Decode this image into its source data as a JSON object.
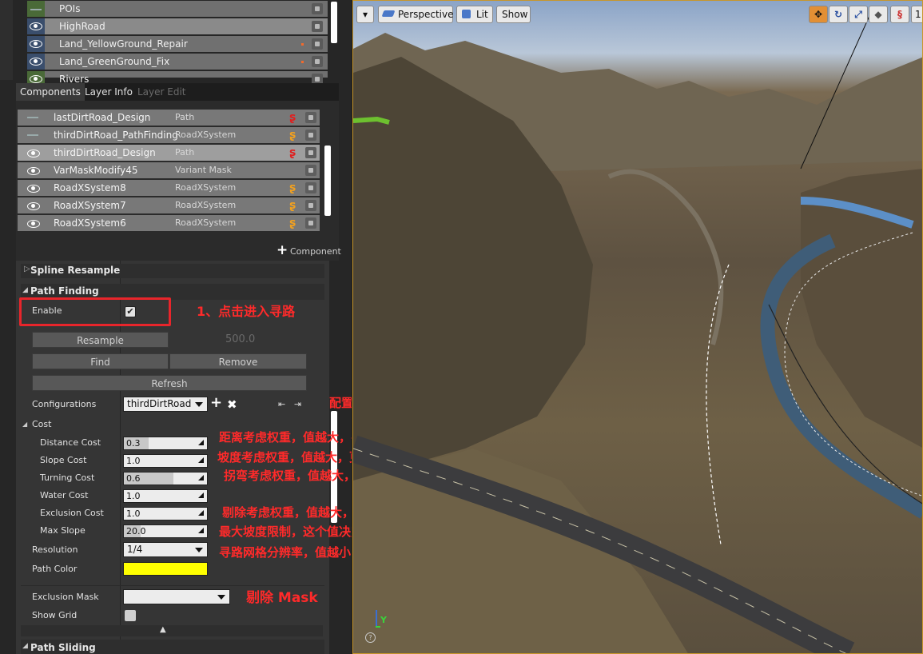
{
  "layers": [
    {
      "name": "POIs",
      "selected": false,
      "visible": false,
      "marker": false
    },
    {
      "name": "HighRoad",
      "selected": true,
      "visible": true,
      "marker": false
    },
    {
      "name": "Land_YellowGround_Repair",
      "selected": false,
      "visible": true,
      "marker": true
    },
    {
      "name": "Land_GreenGround_Fix",
      "selected": false,
      "visible": true,
      "marker": true
    },
    {
      "name": "Rivers",
      "selected": false,
      "visible": true,
      "marker": false
    }
  ],
  "tabs": {
    "components": "Components",
    "layer_info": "Layer Info",
    "layer_edit": "Layer Edit"
  },
  "components": [
    {
      "name": "lastDirtRoad_Design",
      "type": "Path",
      "icon": "dash",
      "spline": "red",
      "selected": false
    },
    {
      "name": "thirdDirtRoad_PathFinding",
      "type": "RoadXSystem",
      "icon": "dash",
      "spline": "orange",
      "selected": false
    },
    {
      "name": "thirdDirtRoad_Design",
      "type": "Path",
      "icon": "eye",
      "spline": "red",
      "selected": true
    },
    {
      "name": "VarMaskModify45",
      "type": "Variant Mask",
      "icon": "eye",
      "spline": "",
      "selected": false
    },
    {
      "name": "RoadXSystem8",
      "type": "RoadXSystem",
      "icon": "eye",
      "spline": "orange",
      "selected": false
    },
    {
      "name": "RoadXSystem7",
      "type": "RoadXSystem",
      "icon": "eye",
      "spline": "orange",
      "selected": false
    },
    {
      "name": "RoadXSystem6",
      "type": "RoadXSystem",
      "icon": "eye",
      "spline": "orange",
      "selected": false
    }
  ],
  "add_component": "Component",
  "sections": {
    "spline_resample": "Spline Resample",
    "path_finding": "Path Finding",
    "path_sliding": "Path Sliding"
  },
  "enable_label": "Enable",
  "buttons": {
    "resample": "Resample",
    "resample_value": "500.0",
    "find": "Find",
    "remove": "Remove",
    "refresh": "Refresh"
  },
  "configurations": {
    "label": "Configurations",
    "value": "thirdDirtRoad"
  },
  "cost": {
    "label": "Cost",
    "items": [
      {
        "label": "Distance Cost",
        "value": "0.3",
        "fill": 0.3
      },
      {
        "label": "Slope Cost",
        "value": "1.0",
        "fill": 0.0
      },
      {
        "label": "Turning Cost",
        "value": "0.6",
        "fill": 0.6
      },
      {
        "label": "Water Cost",
        "value": "1.0",
        "fill": 0.0
      },
      {
        "label": "Exclusion Cost",
        "value": "1.0",
        "fill": 0.0
      },
      {
        "label": "Max Slope",
        "value": "20.0",
        "fill": 0.2
      }
    ]
  },
  "resolution": {
    "label": "Resolution",
    "value": "1/4"
  },
  "path_color": {
    "label": "Path Color",
    "color": "#ffff00"
  },
  "exclusion_mask": {
    "label": "Exclusion Mask",
    "value": ""
  },
  "show_grid": {
    "label": "Show Grid"
  },
  "annotations": {
    "enable": "1、点击进入寻路",
    "config": "配置导入导出",
    "distance": "距离考虑权重，值越大，寻路结果越短",
    "slope": "坡度考虑权重，值越大，更容易在平坦的区域寻路",
    "turning": "拐弯考虑权重，值越大，越不容易拐弯",
    "exclusion": "剔除考虑权重，值越大，越倾向于回避剔除Mask",
    "max_slope": "最大坡度限制，这个值决定寻路爬坡的坡度上限",
    "resolution": "寻路网格分辨率，值越小，分辨率越低，公路、铁路等规格高的道路适合用小一点的寻路网格生成",
    "exclusion_mask": "剔除 Mask"
  },
  "viewport": {
    "perspective": "Perspective",
    "lit": "Lit",
    "show": "Show",
    "corner_digit": "1"
  },
  "colors": {
    "annotation": "#ff2a2a",
    "highlight_box": "#e8252b",
    "viewport_border": "#c8962a"
  }
}
